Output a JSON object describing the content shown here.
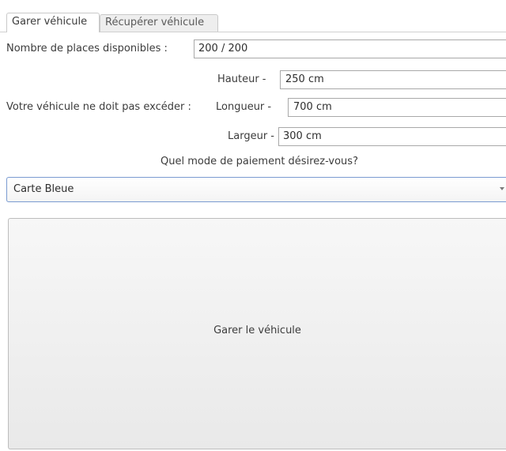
{
  "tabs": [
    {
      "label": "Garer véhicule",
      "active": true
    },
    {
      "label": "Récupérer véhicule",
      "active": false
    }
  ],
  "places": {
    "label": "Nombre de places disponibles :",
    "value": "200 / 200"
  },
  "dimensions": {
    "label": "Votre véhicule ne doit pas excéder :",
    "hauteur_label": "Hauteur -",
    "hauteur_value": "250 cm",
    "longueur_label": "Longueur -",
    "longueur_value": "700 cm",
    "largeur_label": "Largeur -",
    "largeur_value": "300 cm"
  },
  "payment": {
    "question": "Quel mode de paiement désirez-vous?",
    "selected": "Carte Bleue"
  },
  "action": {
    "button_label": "Garer le véhicule"
  },
  "colors": {
    "combo_focus_border": "#7a9bd1",
    "inactive_tab_bg": "#eeeeee"
  }
}
